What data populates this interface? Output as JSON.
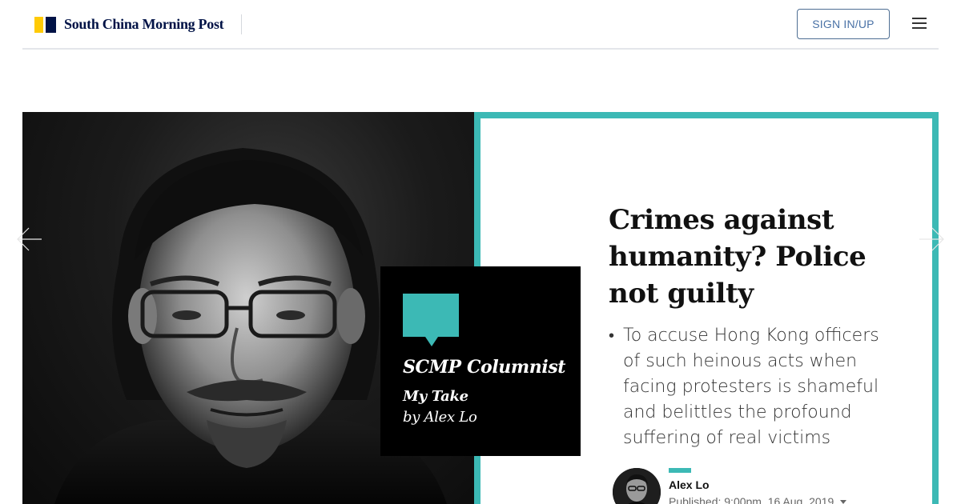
{
  "header": {
    "logo_text": "South China Morning Post",
    "signin_label": "SIGN IN/UP",
    "menu_icon": "hamburger-menu-icon"
  },
  "colors": {
    "teal_accent": "#3cb9b5",
    "logo_yellow": "#ffca05",
    "logo_navy": "#001246",
    "signin_text": "#4a72a6"
  },
  "columnist": {
    "title": "SCMP Columnist",
    "column_name": "My Take",
    "byline": "by Alex Lo",
    "icon": "speech-bubble-icon"
  },
  "article": {
    "headline": "Crimes against humanity? Police not guilty",
    "summary": "To accuse Hong Kong officers of such heinous acts when facing protesters is shameful and belittles the profound suffering of real victims",
    "author": "Alex Lo",
    "published": "Published: 9:00pm, 16 Aug, 2019"
  },
  "nav": {
    "prev_icon": "arrow-left-icon",
    "next_icon": "arrow-right-icon"
  }
}
